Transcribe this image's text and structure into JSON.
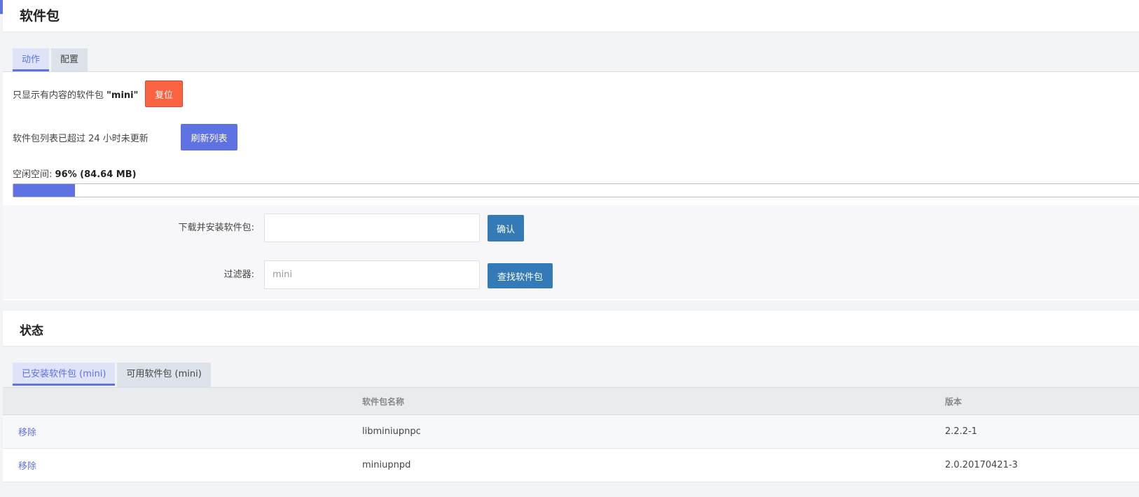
{
  "page": {
    "title": "软件包",
    "accent_color": "#5e72e4"
  },
  "actions": {
    "tabs": [
      {
        "label": "动作",
        "active": true
      },
      {
        "label": "配置",
        "active": false
      }
    ],
    "filter_notice_prefix": "只显示有内容的软件包",
    "filter_notice_value": "\"mini\"",
    "reset_label": "复位",
    "list_outdated_text": "软件包列表已超过 24 小时未更新",
    "refresh_label": "刷新列表",
    "free_space_label": "空闲空间:",
    "free_space_value": "96% (84.64 MB)",
    "used_space_fraction": 0.055,
    "install_label": "下载并安装软件包:",
    "install_value": "",
    "confirm_label": "确认",
    "filter_label": "过滤器:",
    "filter_placeholder": "mini",
    "search_label": "查找软件包"
  },
  "status": {
    "title": "状态",
    "tabs": [
      {
        "label": "已安装软件包 (mini)",
        "active": true
      },
      {
        "label": "可用软件包 (mini)",
        "active": false
      }
    ],
    "table": {
      "headers": [
        "",
        "软件包名称",
        "版本"
      ],
      "rows": [
        {
          "action": "移除",
          "name": "libminiupnpc",
          "version": "2.2.2-1"
        },
        {
          "action": "移除",
          "name": "miniupnpd",
          "version": "2.0.20170421-3"
        }
      ]
    }
  },
  "colors": {
    "primary": "#5e72e4",
    "danger": "#fb6340",
    "info": "#337ab7"
  }
}
